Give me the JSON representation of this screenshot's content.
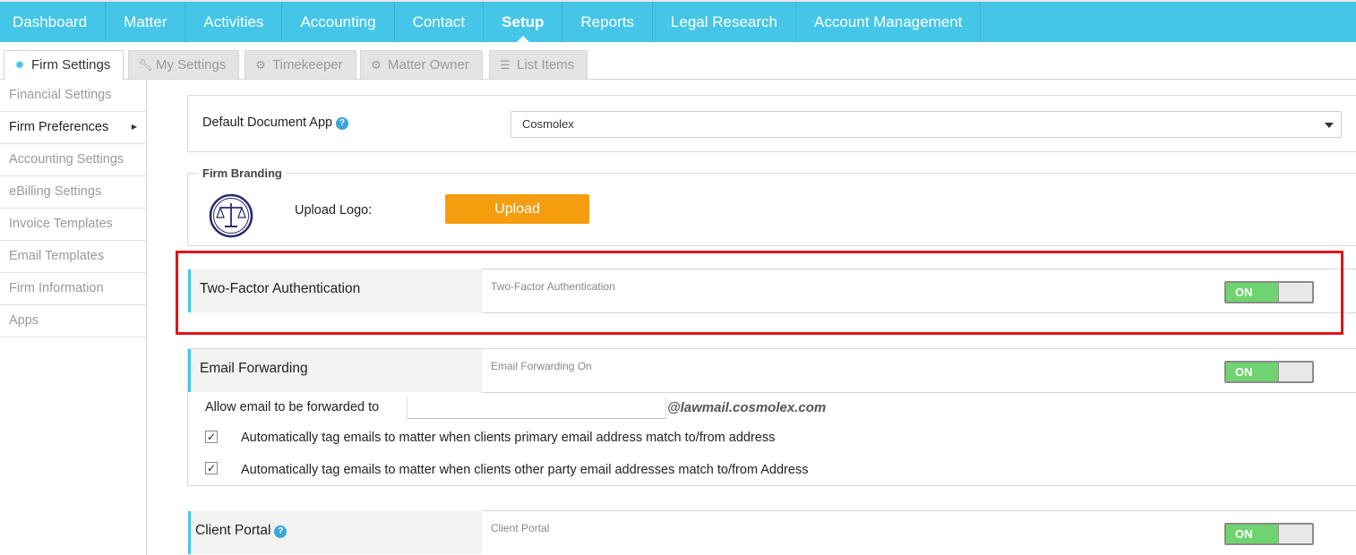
{
  "topnav": {
    "items": [
      "Dashboard",
      "Matter",
      "Activities",
      "Accounting",
      "Contact",
      "Setup",
      "Reports",
      "Legal Research",
      "Account Management"
    ],
    "active": "Setup"
  },
  "subtabs": [
    {
      "label": "Firm Settings",
      "icon": "gear-badge-icon"
    },
    {
      "label": "My Settings",
      "icon": "wrench-icon"
    },
    {
      "label": "Timekeeper",
      "icon": "gears-icon"
    },
    {
      "label": "Matter Owner",
      "icon": "gear-icon"
    },
    {
      "label": "List Items",
      "icon": "list-icon"
    }
  ],
  "sidebar": {
    "items": [
      "Financial Settings",
      "Firm Preferences",
      "Accounting Settings",
      "eBilling Settings",
      "Invoice Templates",
      "Email Templates",
      "Firm Information",
      "Apps"
    ],
    "active": "Firm Preferences"
  },
  "document_app": {
    "label": "Default Document App",
    "selected": "Cosmolex"
  },
  "firm_branding": {
    "legend": "Firm Branding",
    "upload_label": "Upload Logo:",
    "upload_button": "Upload"
  },
  "two_factor": {
    "title": "Two-Factor Authentication",
    "description": "Two-Factor Authentication",
    "toggle": "ON"
  },
  "email_forwarding": {
    "title": "Email Forwarding",
    "description": "Email Forwarding On",
    "toggle": "ON",
    "forward_label": "Allow email to be forwarded to",
    "forward_value": "",
    "domain": "@lawmail.cosmolex.com",
    "options": [
      {
        "label": "Automatically tag emails to matter when clients primary email address match to/from address",
        "checked": true
      },
      {
        "label": "Automatically tag emails to matter when clients other party email addresses match to/from Address",
        "checked": true
      }
    ]
  },
  "client_portal": {
    "title": "Client Portal",
    "description": "Client Portal",
    "toggle": "ON"
  },
  "colors": {
    "nav": "#45c6e8",
    "upload": "#f59d0e",
    "toggle_on": "#6fd46f",
    "highlight": "#e0141b"
  }
}
